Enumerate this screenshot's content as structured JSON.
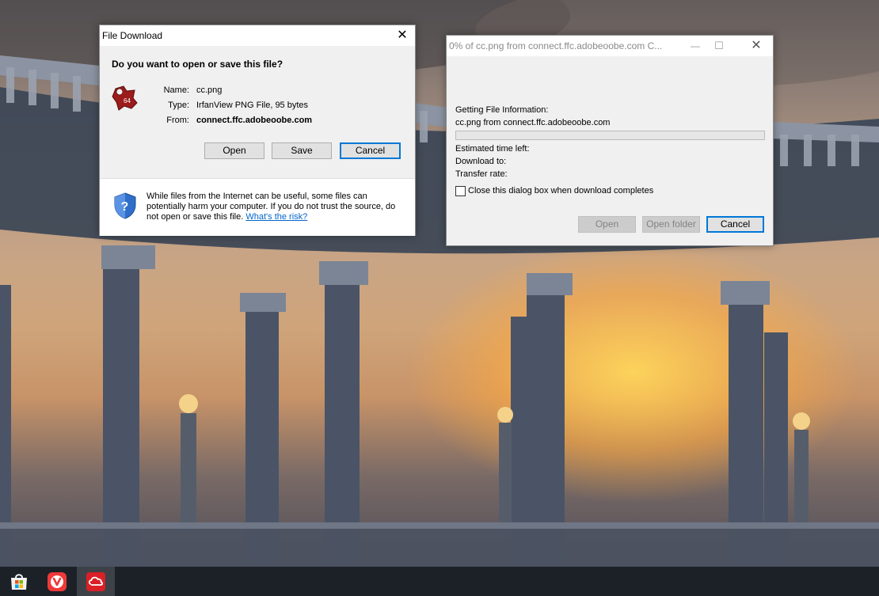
{
  "file_download": {
    "title": "File Download",
    "close_glyph": "✕",
    "heading": "Do you want to open or save this file?",
    "file_icon": "irfanview-png-file-icon",
    "file_icon_badge": "64",
    "name_label": "Name:",
    "name_value": "cc.png",
    "type_label": "Type:",
    "type_value": "IrfanView PNG File, 95 bytes",
    "from_label": "From:",
    "from_value": "connect.ffc.adobeoobe.com",
    "open_label": "Open",
    "save_label": "Save",
    "cancel_label": "Cancel",
    "warning_icon": "shield-question-icon",
    "warning_text": "While files from the Internet can be useful, some files can potentially harm your computer. If you do not trust the source, do not open or save this file.",
    "risk_link": "What's the risk?"
  },
  "progress_dialog": {
    "title": "0% of cc.png from connect.ffc.adobeoobe.com C...",
    "minimize_glyph": "—",
    "maximize_glyph": "☐",
    "close_glyph": "✕",
    "status": "Getting File Information:",
    "file_line": "cc.png from connect.ffc.adobeoobe.com",
    "progress_percent": 0,
    "estimated_label": "Estimated time left:",
    "download_to_label": "Download to:",
    "transfer_rate_label": "Transfer rate:",
    "close_checkbox_label": "Close this dialog box when download completes",
    "close_checkbox_checked": false,
    "open_label": "Open",
    "open_folder_label": "Open folder",
    "cancel_label": "Cancel"
  },
  "taskbar": {
    "items": [
      {
        "icon": "microsoft-store-icon",
        "active": false
      },
      {
        "icon": "vivaldi-browser-icon",
        "active": false
      },
      {
        "icon": "adobe-creative-cloud-icon",
        "active": true
      }
    ]
  },
  "colors": {
    "accent": "#0078d7",
    "link": "#0066cc",
    "taskbar": "#1c2127",
    "creative_cloud_red": "#da1f26",
    "vivaldi_red": "#ef3939"
  }
}
